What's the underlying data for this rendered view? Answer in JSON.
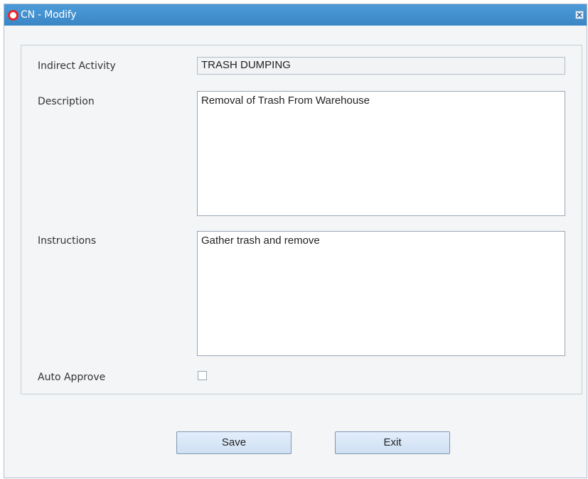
{
  "window": {
    "title": "CN - Modify",
    "logo_icon": "oracle-logo-icon",
    "close_icon": "close-icon"
  },
  "form": {
    "indirect_activity": {
      "label": "Indirect Activity",
      "value": "TRASH DUMPING"
    },
    "description": {
      "label": "Description",
      "value": "Removal of Trash From Warehouse"
    },
    "instructions": {
      "label": "Instructions",
      "value": "Gather trash and remove"
    },
    "auto_approve": {
      "label": "Auto Approve",
      "checked": false
    }
  },
  "buttons": {
    "save": "Save",
    "exit": "Exit"
  },
  "colors": {
    "title_bar": "#3b86c6",
    "panel_bg": "#f3f5f7",
    "button_bg": "#d8e6f6"
  }
}
